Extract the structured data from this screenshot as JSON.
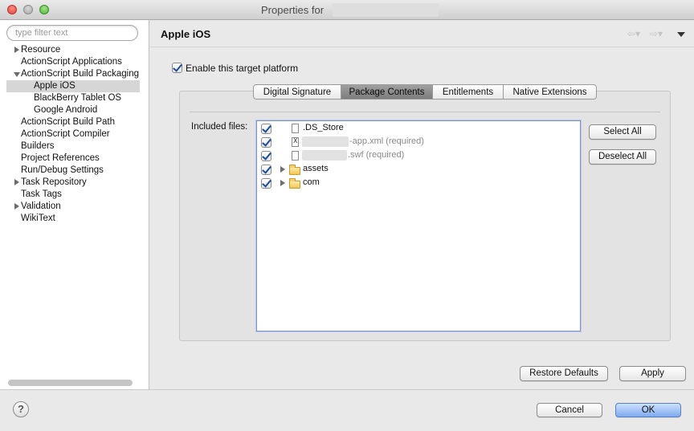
{
  "window": {
    "title": "Properties for"
  },
  "sidebar": {
    "filter_placeholder": "type filter text",
    "items": [
      {
        "label": "Resource"
      },
      {
        "label": "ActionScript Applications"
      },
      {
        "label": "ActionScript Build Packaging"
      },
      {
        "label": "Apple iOS"
      },
      {
        "label": "BlackBerry Tablet OS"
      },
      {
        "label": "Google Android"
      },
      {
        "label": "ActionScript Build Path"
      },
      {
        "label": "ActionScript Compiler"
      },
      {
        "label": "Builders"
      },
      {
        "label": "Project References"
      },
      {
        "label": "Run/Debug Settings"
      },
      {
        "label": "Task Repository"
      },
      {
        "label": "Task Tags"
      },
      {
        "label": "Validation"
      },
      {
        "label": "WikiText"
      }
    ]
  },
  "page": {
    "title": "Apple iOS",
    "enable_label": "Enable this target platform",
    "enable_checked": true
  },
  "tabs": {
    "items": [
      "Digital Signature",
      "Package Contents",
      "Entitlements",
      "Native Extensions"
    ],
    "active": "Package Contents"
  },
  "package": {
    "included_label": "Included files:",
    "files": [
      {
        "name": ".DS_Store",
        "checked": true,
        "icon": "document-icon"
      },
      {
        "name": "-app.xml (required)",
        "checked": true,
        "icon": "xml-document-icon"
      },
      {
        "name": ".swf (required)",
        "checked": true,
        "icon": "document-icon"
      },
      {
        "name": "assets",
        "checked": true,
        "icon": "folder-icon"
      },
      {
        "name": "com",
        "checked": true,
        "icon": "folder-icon"
      }
    ],
    "select_all": "Select All",
    "deselect_all": "Deselect All"
  },
  "actions": {
    "restore_defaults": "Restore Defaults",
    "apply": "Apply",
    "cancel": "Cancel",
    "ok": "OK",
    "help": "?"
  },
  "colors": {
    "accent": "#7faaf0",
    "selection": "#d6d6d6",
    "active_tab": "#8c8c8c"
  }
}
